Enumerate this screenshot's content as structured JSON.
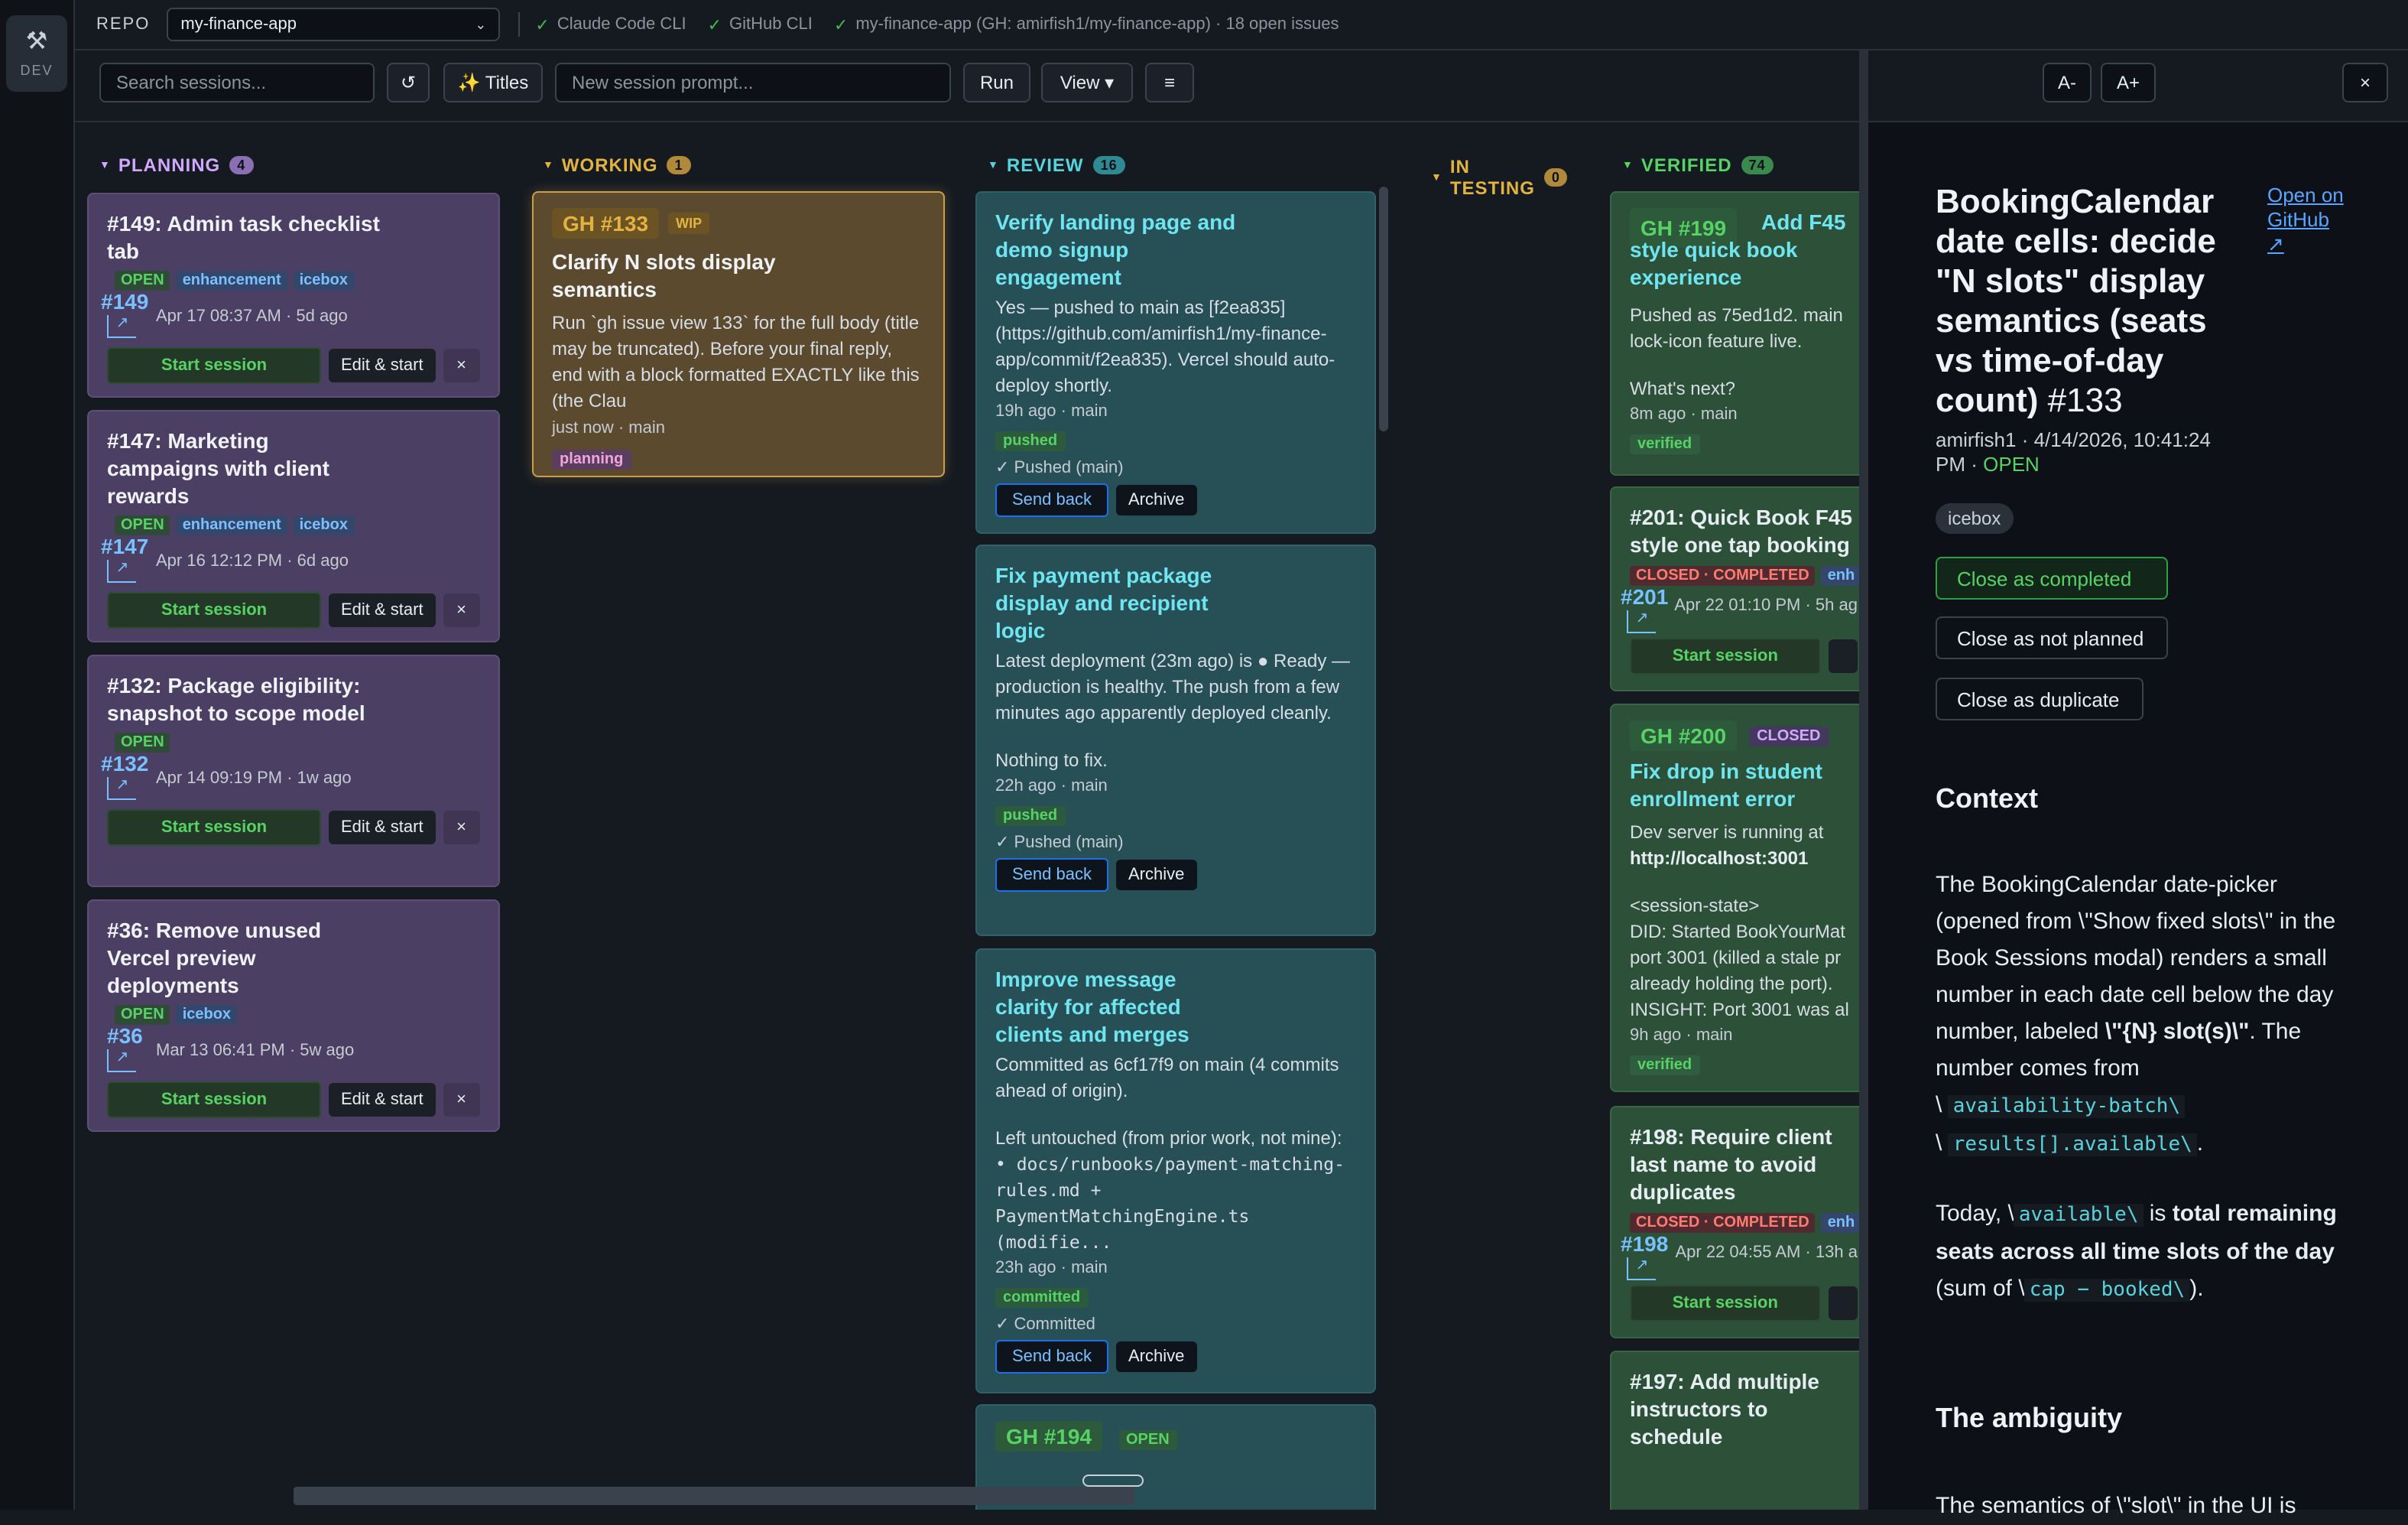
{
  "rail": {
    "label": "DEV",
    "icon": "tools-icon"
  },
  "topbar": {
    "repo_label": "REPO",
    "repo_value": "my-finance-app",
    "status": [
      "Claude Code CLI",
      "GitHub CLI",
      "my-finance-app (GH: amirfish1/my-finance-app) · 18 open issues"
    ]
  },
  "toolbar": {
    "search_placeholder": "Search sessions...",
    "refresh": "↺",
    "titles": "✨ Titles",
    "prompt_placeholder": "New session prompt...",
    "run": "Run",
    "view": "View ▾",
    "menu": "≡"
  },
  "columns": {
    "planning": {
      "title": "PLANNING",
      "count": "4",
      "color": "#d2a8ff"
    },
    "working": {
      "title": "WORKING",
      "count": "1",
      "color": "#e3b341"
    },
    "review": {
      "title": "REVIEW",
      "count": "16",
      "color": "#56d4dd"
    },
    "testing": {
      "title1": "IN",
      "title2": "TESTING",
      "count": "0",
      "color": "#e3b341"
    },
    "verified": {
      "title": "VERIFIED",
      "count": "74",
      "color": "#56d364"
    }
  },
  "planning": [
    {
      "title": "#149: Admin task checklist tab",
      "num": "#149",
      "tags": [
        "OPEN",
        "enhancement",
        "icebox"
      ],
      "meta": "Apr 17 08:37 AM · 5d ago"
    },
    {
      "title": "#147: Marketing campaigns with client rewards",
      "num": "#147",
      "tags": [
        "OPEN",
        "enhancement",
        "icebox"
      ],
      "meta": "Apr 16 12:12 PM · 6d ago"
    },
    {
      "title": "#132: Package eligibility: snapshot to scope model",
      "num": "#132",
      "tags": [
        "OPEN"
      ],
      "meta": "Apr 14 09:19 PM · 1w ago"
    },
    {
      "title": "#36: Remove unused Vercel preview deployments",
      "num": "#36",
      "tags": [
        "OPEN",
        "icebox"
      ],
      "meta": "Mar 13 06:41 PM · 5w ago"
    }
  ],
  "planning_buttons": {
    "start": "Start session",
    "edit": "Edit & start",
    "x": "×"
  },
  "working": {
    "gh": "GH #133",
    "badge": "WIP",
    "title": "Clarify N slots display semantics",
    "body": "Run `gh issue view 133` for the full body (title may be truncated). Before your final reply, end with a block formatted EXACTLY like this (the Clau",
    "meta": "just now · main",
    "pill": "planning"
  },
  "review": [
    {
      "title": "Verify landing page and demo signup engagement",
      "body": "Yes — pushed to main as [f2ea835] (https://github.com/amirfish1/my-finance-app/commit/f2ea835). Vercel should auto-deploy shortly.",
      "meta": "19h ago · main",
      "pill": "pushed",
      "status": "✓ Pushed (main)"
    },
    {
      "title": "Fix payment package display and recipient logic",
      "body": "Latest deployment (23m ago) is ● Ready — production is healthy. The push from a few minutes ago apparently deployed cleanly.",
      "body2": "Nothing to fix.",
      "meta": "22h ago · main",
      "pill": "pushed",
      "status": "✓ Pushed (main)"
    },
    {
      "title": "Improve message clarity for affected clients and merges",
      "body": "Committed as 6cf17f9 on main (4 commits ahead of origin).",
      "body2": "Left untouched (from prior work, not mine):",
      "body3": "• docs/runbooks/payment-matching-rules.md + PaymentMatchingEngine.ts (modifie...",
      "meta": "23h ago · main",
      "pill": "committed",
      "status": "✓ Committed"
    }
  ],
  "review_last": {
    "gh": "GH #194",
    "badge": "OPEN"
  },
  "review_buttons": {
    "send": "Send back",
    "archive": "Archive"
  },
  "verified": [
    {
      "gh": "GH #199",
      "title": "Add F45 style quick book experience",
      "body": "Pushed as 75ed1d2. main lock-icon feature live.",
      "body2": "What's next?",
      "meta": "8m ago · main",
      "pill": "verified"
    },
    {
      "title": "#201: Quick Book F45 style one tap booking",
      "num": "#201",
      "tags": [
        "CLOSED · COMPLETED",
        "enh"
      ],
      "meta": "Apr 22 01:10 PM · 5h ag",
      "start": "Start session"
    },
    {
      "gh": "GH #200",
      "badge": "CLOSED",
      "title": "Fix drop in student enrollment error",
      "body": "Dev server is running at",
      "bold": "http://localhost:3001",
      "body2": "<session-state>",
      "body3": "DID: Started BookYourMat port 3001 (killed a stale pr already holding the port). INSIGHT: Port 3001 was al",
      "meta": "9h ago · main",
      "pill": "verified"
    },
    {
      "title": "#198: Require client last name to avoid duplicates",
      "num": "#198",
      "tags": [
        "CLOSED · COMPLETED",
        "enh"
      ],
      "meta": "Apr 22 04:55 AM · 13h a",
      "start": "Start session"
    },
    {
      "title": "#197: Add multiple instructors to schedule"
    }
  ],
  "panel": {
    "font_minus": "A-",
    "font_plus": "A+",
    "close": "×",
    "title": "BookingCalendar date cells: decide \"N slots\" display semantics (seats vs time-of-day count)",
    "num": "#133",
    "link": "Open on GitHub ↗",
    "meta_user": "amirfish1 · 4/14/2026, 10:41:24 PM · ",
    "meta_state": "OPEN",
    "chip": "icebox",
    "actions": [
      "Close as completed",
      "Close as not planned",
      "Close as duplicate"
    ],
    "context_h": "Context",
    "p1a": "The BookingCalendar date-picker (opened from \\\"Show fixed slots\\\" in the Book Sessions modal) renders a small number in each date cell below the day number, labeled ",
    "p1b": "\\\"{N} slot(s)\\\"",
    "p1c": ". The number comes from ",
    "code1": "availability-batch\\",
    "code2": "results[].available\\",
    "p2a": "Today, \\",
    "code3": "available\\",
    "p2b": " is ",
    "p2bold": "total remaining seats across all time slots of the day",
    "p2c": " (sum of \\",
    "code4": "cap − booked\\",
    "p2d": ").",
    "amb_h": "The ambiguity",
    "amb_p": "The semantics of \\\"slot\\\" in the UI is"
  },
  "colors": {
    "bg": "#151a21",
    "planning": "#4b3f63",
    "working": "#5b4a2e",
    "review": "#275056",
    "verified": "#2d5138",
    "accent_green": "#56d364",
    "accent_cyan": "#56d4dd"
  }
}
